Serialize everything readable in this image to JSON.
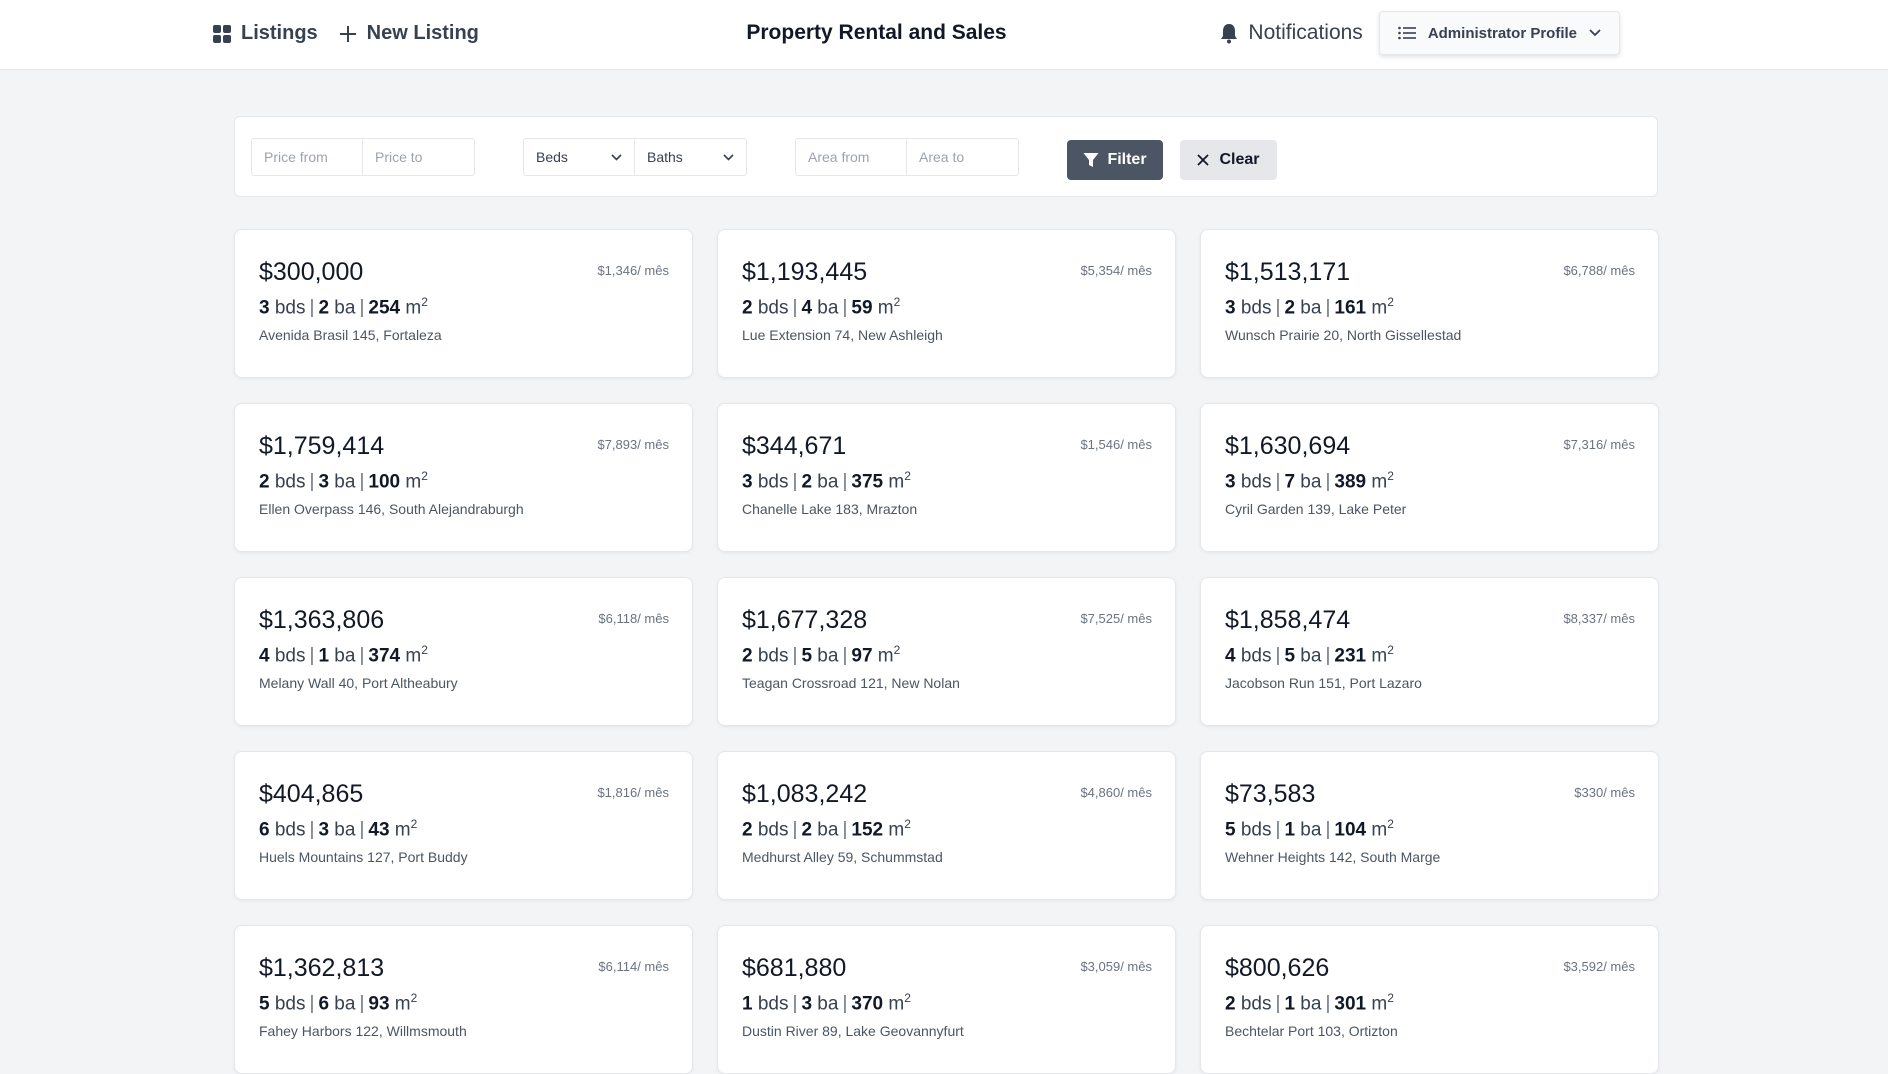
{
  "nav": {
    "listings": "Listings",
    "new_listing": "New Listing",
    "title": "Property Rental and Sales",
    "notifications": "Notifications",
    "profile": "Administrator Profile"
  },
  "filters": {
    "price_from": "Price from",
    "price_to": "Price to",
    "beds": "Beds",
    "baths": "Baths",
    "area_from": "Area from",
    "area_to": "Area to",
    "filter_btn": "Filter",
    "clear_btn": "Clear"
  },
  "labels": {
    "bds": "bds",
    "ba": "ba",
    "unit": "m",
    "unit_sup": "2",
    "per_month": "/ mês"
  },
  "listings": [
    {
      "price": "$300,000",
      "monthly": "$1,346",
      "beds": "3",
      "baths": "2",
      "area": "254",
      "address": "Avenida Brasil 145, Fortaleza"
    },
    {
      "price": "$1,193,445",
      "monthly": "$5,354",
      "beds": "2",
      "baths": "4",
      "area": "59",
      "address": "Lue Extension 74, New Ashleigh"
    },
    {
      "price": "$1,513,171",
      "monthly": "$6,788",
      "beds": "3",
      "baths": "2",
      "area": "161",
      "address": "Wunsch Prairie 20, North Gissellestad"
    },
    {
      "price": "$1,759,414",
      "monthly": "$7,893",
      "beds": "2",
      "baths": "3",
      "area": "100",
      "address": "Ellen Overpass 146, South Alejandraburgh"
    },
    {
      "price": "$344,671",
      "monthly": "$1,546",
      "beds": "3",
      "baths": "2",
      "area": "375",
      "address": "Chanelle Lake 183, Mrazton"
    },
    {
      "price": "$1,630,694",
      "monthly": "$7,316",
      "beds": "3",
      "baths": "7",
      "area": "389",
      "address": "Cyril Garden 139, Lake Peter"
    },
    {
      "price": "$1,363,806",
      "monthly": "$6,118",
      "beds": "4",
      "baths": "1",
      "area": "374",
      "address": "Melany Wall 40, Port Altheabury"
    },
    {
      "price": "$1,677,328",
      "monthly": "$7,525",
      "beds": "2",
      "baths": "5",
      "area": "97",
      "address": "Teagan Crossroad 121, New Nolan"
    },
    {
      "price": "$1,858,474",
      "monthly": "$8,337",
      "beds": "4",
      "baths": "5",
      "area": "231",
      "address": "Jacobson Run 151, Port Lazaro"
    },
    {
      "price": "$404,865",
      "monthly": "$1,816",
      "beds": "6",
      "baths": "3",
      "area": "43",
      "address": "Huels Mountains 127, Port Buddy"
    },
    {
      "price": "$1,083,242",
      "monthly": "$4,860",
      "beds": "2",
      "baths": "2",
      "area": "152",
      "address": "Medhurst Alley 59, Schummstad"
    },
    {
      "price": "$73,583",
      "monthly": "$330",
      "beds": "5",
      "baths": "1",
      "area": "104",
      "address": "Wehner Heights 142, South Marge"
    },
    {
      "price": "$1,362,813",
      "monthly": "$6,114",
      "beds": "5",
      "baths": "6",
      "area": "93",
      "address": "Fahey Harbors 122, Willmsmouth"
    },
    {
      "price": "$681,880",
      "monthly": "$3,059",
      "beds": "1",
      "baths": "3",
      "area": "370",
      "address": "Dustin River 89, Lake Geovannyfurt"
    },
    {
      "price": "$800,626",
      "monthly": "$3,592",
      "beds": "2",
      "baths": "1",
      "area": "301",
      "address": "Bechtelar Port 103, Ortizton"
    }
  ]
}
